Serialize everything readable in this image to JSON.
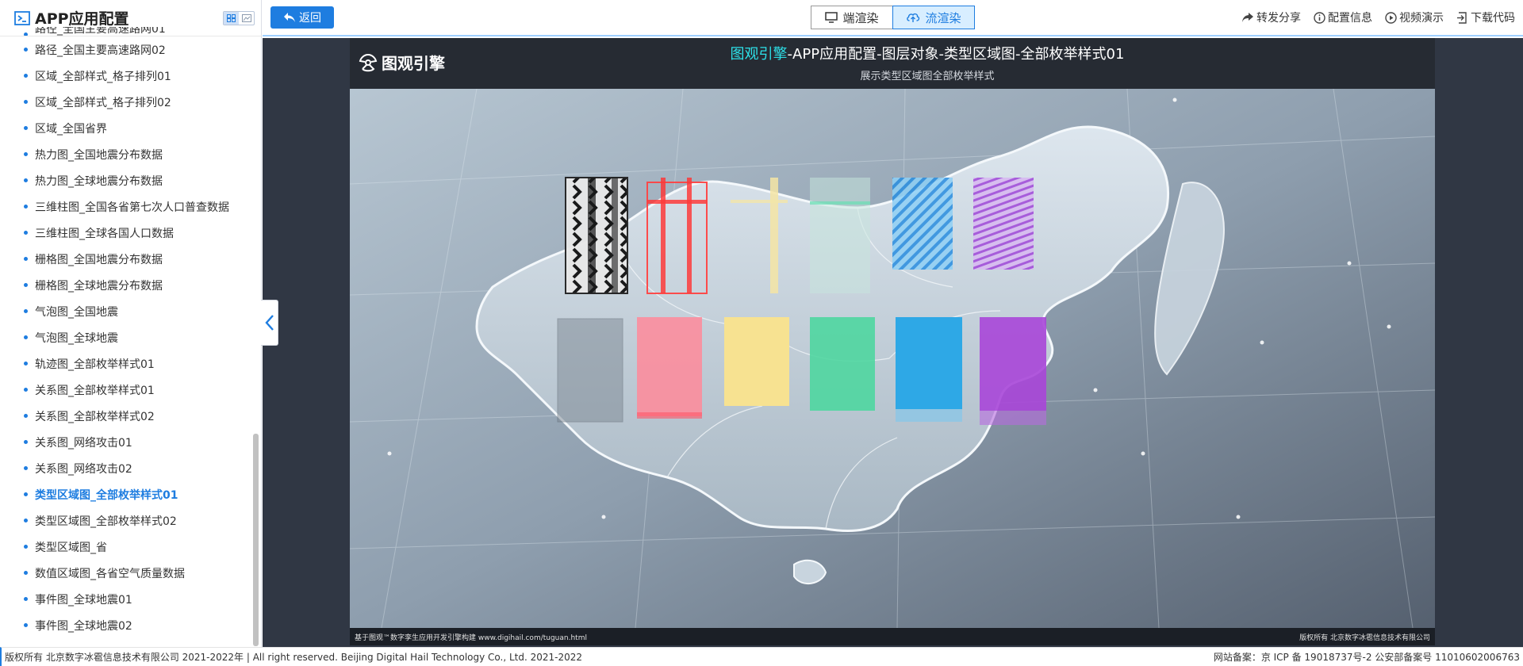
{
  "sidebar": {
    "title": "APP应用配置",
    "clipped_item": "路径_全国主要高速路网01",
    "items": [
      {
        "label": "路径_全国主要高速路网02",
        "active": false
      },
      {
        "label": "区域_全部样式_格子排列01",
        "active": false
      },
      {
        "label": "区域_全部样式_格子排列02",
        "active": false
      },
      {
        "label": "区域_全国省界",
        "active": false
      },
      {
        "label": "热力图_全国地震分布数据",
        "active": false
      },
      {
        "label": "热力图_全球地震分布数据",
        "active": false
      },
      {
        "label": "三维柱图_全国各省第七次人口普查数据",
        "active": false
      },
      {
        "label": "三维柱图_全球各国人口数据",
        "active": false
      },
      {
        "label": "栅格图_全国地震分布数据",
        "active": false
      },
      {
        "label": "栅格图_全球地震分布数据",
        "active": false
      },
      {
        "label": "气泡图_全国地震",
        "active": false
      },
      {
        "label": "气泡图_全球地震",
        "active": false
      },
      {
        "label": "轨迹图_全部枚举样式01",
        "active": false
      },
      {
        "label": "关系图_全部枚举样式01",
        "active": false
      },
      {
        "label": "关系图_全部枚举样式02",
        "active": false
      },
      {
        "label": "关系图_网络攻击01",
        "active": false
      },
      {
        "label": "关系图_网络攻击02",
        "active": false
      },
      {
        "label": "类型区域图_全部枚举样式01",
        "active": true
      },
      {
        "label": "类型区域图_全部枚举样式02",
        "active": false
      },
      {
        "label": "类型区域图_省",
        "active": false
      },
      {
        "label": "数值区域图_各省空气质量数据",
        "active": false
      },
      {
        "label": "事件图_全球地震01",
        "active": false
      },
      {
        "label": "事件图_全球地震02",
        "active": false
      }
    ]
  },
  "topbar": {
    "back_label": "返回",
    "render_client_label": "端渲染",
    "render_stream_label": "流渲染",
    "active_render": "stream",
    "tools": [
      {
        "label": "转发分享",
        "icon": "share-icon"
      },
      {
        "label": "配置信息",
        "icon": "info-icon"
      },
      {
        "label": "视频演示",
        "icon": "play-icon"
      },
      {
        "label": "下载代码",
        "icon": "download-icon"
      }
    ]
  },
  "frame": {
    "logo_text": "图观引擎",
    "title_highlight": "图观引擎",
    "title_rest": "-APP应用配置-图层对象-类型区域图-全部枚举样式01",
    "subtitle": "展示类型区域图全部枚举样式",
    "footer_left": "基于图观™数字孪生应用开发引擎构建 www.digihail.com/tuguan.html",
    "footer_right": "版权所有 北京数字冰雹信息技术有限公司"
  },
  "copyright": {
    "left": "版权所有 北京数字冰雹信息技术有限公司 2021-2022年 | All right reserved. Beijing Digital Hail Technology Co., Ltd. 2021-2022",
    "right": "网站备案：京 ICP 备 19018737号-2 公安部备案号 11010602006763"
  },
  "colors": {
    "accent": "#1e7de0",
    "title_highlight": "#2de0e8",
    "stage_bg": "#303744"
  }
}
